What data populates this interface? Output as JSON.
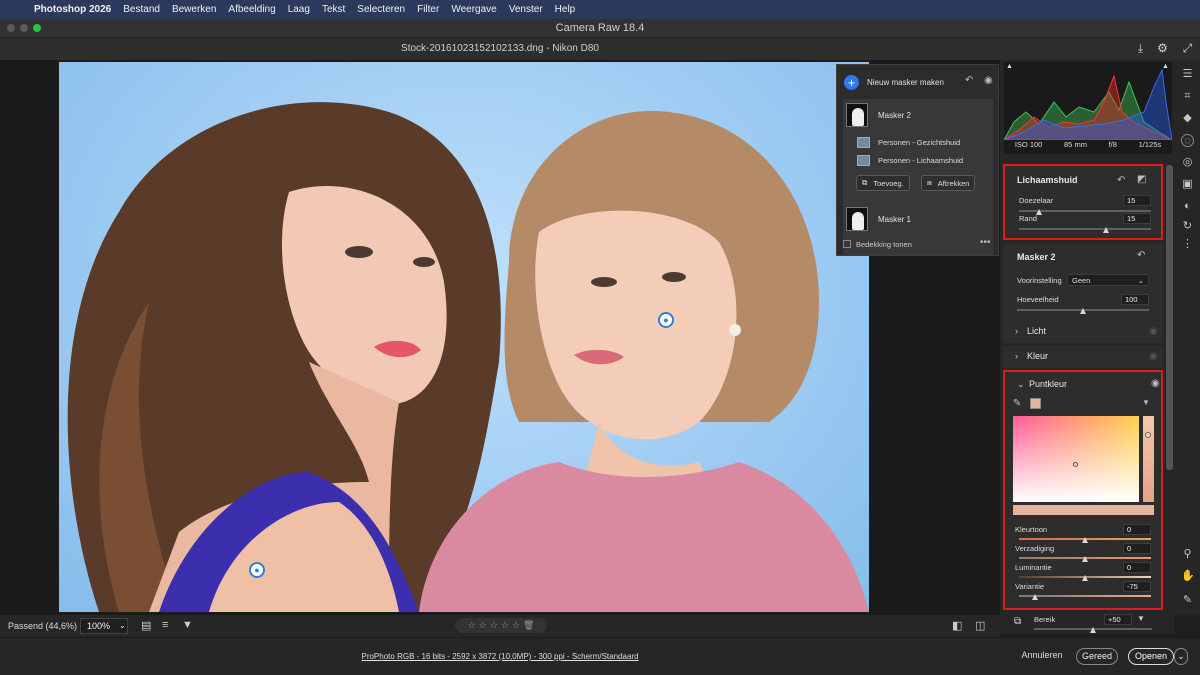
{
  "menubar": {
    "items": [
      "Photoshop 2026",
      "Bestand",
      "Bewerken",
      "Afbeelding",
      "Laag",
      "Tekst",
      "Selecteren",
      "Filter",
      "Weergave",
      "Venster",
      "Help"
    ]
  },
  "window": {
    "title": "Camera Raw 18.4"
  },
  "file": {
    "name": "Stock-20161023152102133.dng  -  Nikon D80"
  },
  "masks": {
    "new_mask_label": "Nieuw masker maken",
    "mask2_label": "Masker 2",
    "sub1_label": "Personen - Gezichtshuid",
    "sub2_label": "Personen - Lichaamshuid",
    "add_label": "Toevoeg.",
    "subtract_label": "Aftrekken",
    "mask1_label": "Masker 1",
    "overlay_label": "Bedekking tonen"
  },
  "exif": {
    "iso": "ISO 100",
    "focal": "85 mm",
    "aperture": "f/8",
    "shutter": "1/125s"
  },
  "lichaamshuid": {
    "title": "Lichaamshuid",
    "doezelaar_label": "Doezelaar",
    "doezelaar_value": "15",
    "doezelaar_pct": 0.15,
    "rand_label": "Rand",
    "rand_value": "15",
    "rand_pct": 0.66
  },
  "masker2": {
    "title": "Masker 2",
    "preset_label": "Voorinstelling",
    "preset_value": "Geen",
    "amount_label": "Hoeveelheid",
    "amount_value": "100",
    "amount_pct": 0.5
  },
  "sections": {
    "licht": "Licht",
    "kleur": "Kleur"
  },
  "puntkleur": {
    "title": "Puntkleur",
    "hue_label": "Kleurtoon",
    "hue_value": "0",
    "hue_pct": 0.5,
    "sat_label": "Verzadiging",
    "sat_value": "0",
    "sat_pct": 0.5,
    "lum_label": "Luminantie",
    "lum_value": "0",
    "lum_pct": 0.5,
    "var_label": "Variantie",
    "var_value": "-75",
    "var_pct": 0.12
  },
  "bereik": {
    "label": "Bereik",
    "value": "+50",
    "pct": 0.5
  },
  "bottom": {
    "zoom_label": "Passend (44,6%)",
    "zoom_value": "100%"
  },
  "status": {
    "info": "ProPhoto RGB - 16 bits - 2592 x 3872 (10,0MP) - 300 ppi - Scherm/Standaard"
  },
  "buttons": {
    "cancel": "Annuleren",
    "done": "Gereed",
    "open": "Openen"
  },
  "colors": {
    "highlight": "#e01b1b",
    "accent": "#2a7be4"
  }
}
